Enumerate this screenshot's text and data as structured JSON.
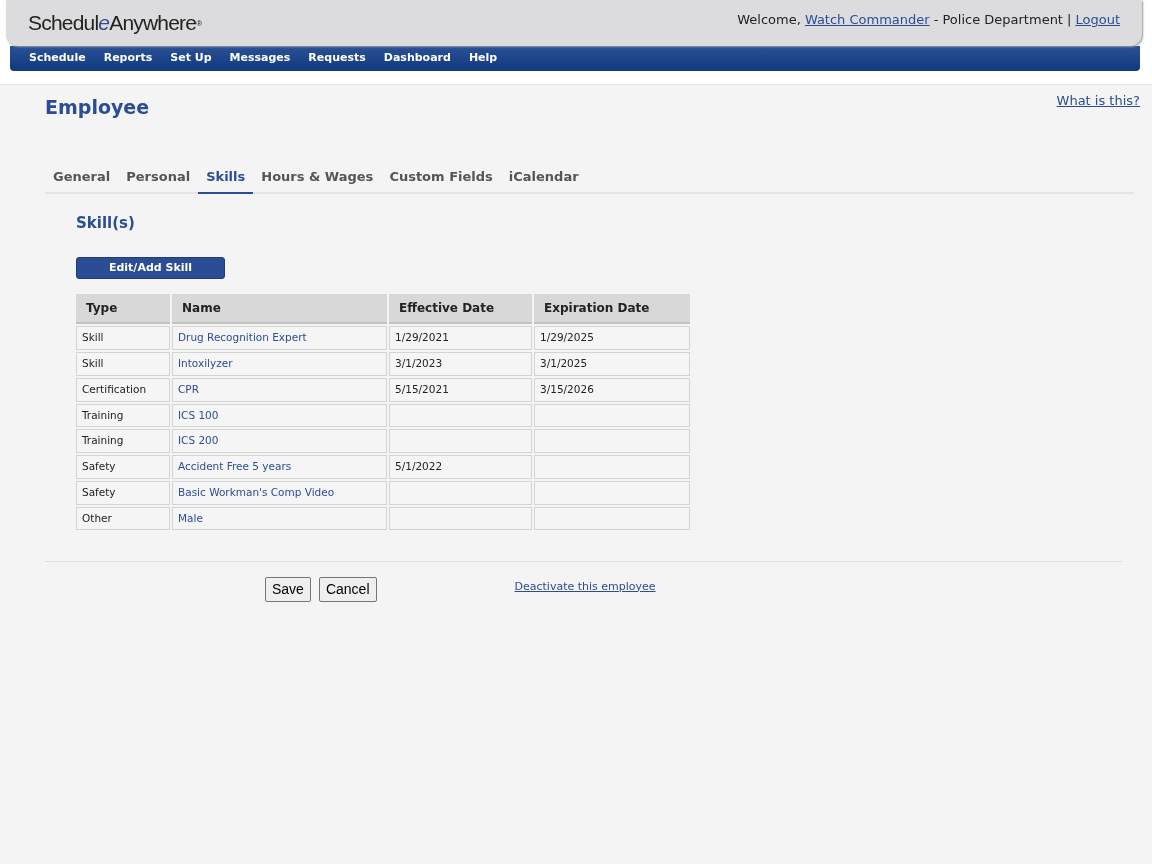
{
  "header": {
    "logo": {
      "before": "Schedul",
      "italic": "e",
      "after": "Anywhere",
      "mark": "®"
    },
    "welcome_prefix": "Welcome,",
    "user_link": "Watch Commander",
    "organization": "- Police Department |",
    "logout_link": "Logout"
  },
  "menu": [
    "Schedule",
    "Reports",
    "Set Up",
    "Messages",
    "Requests",
    "Dashboard",
    "Help"
  ],
  "page": {
    "title": "Employee",
    "help_link": "What is this?"
  },
  "tabs": [
    {
      "label": "General",
      "selected": false
    },
    {
      "label": "Personal",
      "selected": false
    },
    {
      "label": "Skills",
      "selected": true
    },
    {
      "label": "Hours & Wages",
      "selected": false
    },
    {
      "label": "Custom Fields",
      "selected": false
    },
    {
      "label": "iCalendar",
      "selected": false
    }
  ],
  "section": {
    "title": "Skill(s)",
    "button": "Edit/Add Skill"
  },
  "table": {
    "columns": [
      "Type",
      "Name",
      "Effective Date",
      "Expiration Date"
    ],
    "rows": [
      [
        "Skill",
        "Drug Recognition Expert",
        "1/29/2021",
        "1/29/2025"
      ],
      [
        "Skill",
        "Intoxilyzer",
        "3/1/2023",
        "3/1/2025"
      ],
      [
        "Certification",
        "CPR",
        "5/15/2021",
        "3/15/2026"
      ],
      [
        "Training",
        "ICS 100",
        "",
        ""
      ],
      [
        "Training",
        "ICS 200",
        "",
        ""
      ],
      [
        "Safety",
        "Accident Free 5 years",
        "5/1/2022",
        ""
      ],
      [
        "Safety",
        "Basic Workman's Comp Video",
        "",
        ""
      ],
      [
        "Other",
        "Male",
        "",
        ""
      ]
    ]
  },
  "footer": {
    "buttons": [
      "Save",
      "Cancel"
    ],
    "deactivate_link": "Deactivate this employee"
  }
}
